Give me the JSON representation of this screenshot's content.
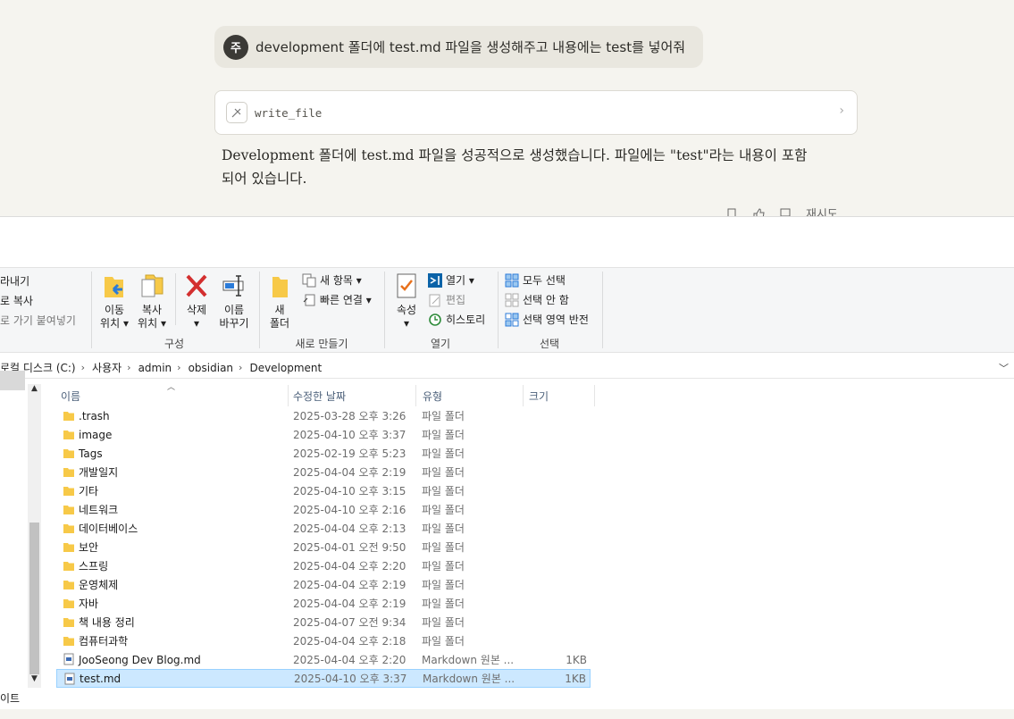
{
  "chat": {
    "avatar_initial": "주",
    "user_message": "development 폴더에 test.md 파일을 생성해주고 내용에는 test를 넣어줘",
    "tool_name": "write_file",
    "assistant_line1": "Development 폴더에 test.md 파일을 성공적으로 생성했습니다. 파일에는 \"test\"라는 내용이 포함",
    "assistant_line2": "되어 있습니다.",
    "retry_label": "재시도"
  },
  "ribbon": {
    "clipboard": {
      "cut_partial": "라내기",
      "copy_path_partial": "로 복사",
      "paste_shortcut_partial": "로 가기 붙여넣기"
    },
    "organize": {
      "move_to": [
        "이동",
        "위치"
      ],
      "copy_to": [
        "복사",
        "위치"
      ],
      "delete": "삭제",
      "rename": [
        "이름",
        "바꾸기"
      ],
      "label": "구성"
    },
    "new": {
      "new_folder": [
        "새",
        "폴더"
      ],
      "new_item": "새 항목",
      "easy_access": "빠른 연결",
      "label": "새로 만들기"
    },
    "open": {
      "properties": "속성",
      "open": "열기",
      "edit": "편집",
      "history": "히스토리",
      "label": "열기"
    },
    "select": {
      "select_all": "모두 선택",
      "select_none": "선택 안 함",
      "invert": "선택 영역 반전",
      "label": "선택"
    }
  },
  "address": [
    "로컬 디스크 (C:)",
    "사용자",
    "admin",
    "obsidian",
    "Development"
  ],
  "columns": {
    "name": "이름",
    "date": "수정한 날짜",
    "type": "유형",
    "size": "크기"
  },
  "files": [
    {
      "name": ".trash",
      "date": "2025-03-28 오후 3:26",
      "type": "파일 폴더",
      "size": "",
      "kind": "folder"
    },
    {
      "name": "image",
      "date": "2025-04-10 오후 3:37",
      "type": "파일 폴더",
      "size": "",
      "kind": "folder"
    },
    {
      "name": "Tags",
      "date": "2025-02-19 오후 5:23",
      "type": "파일 폴더",
      "size": "",
      "kind": "folder"
    },
    {
      "name": "개발일지",
      "date": "2025-04-04 오후 2:19",
      "type": "파일 폴더",
      "size": "",
      "kind": "folder"
    },
    {
      "name": "기타",
      "date": "2025-04-10 오후 3:15",
      "type": "파일 폴더",
      "size": "",
      "kind": "folder"
    },
    {
      "name": "네트워크",
      "date": "2025-04-10 오후 2:16",
      "type": "파일 폴더",
      "size": "",
      "kind": "folder"
    },
    {
      "name": "데이터베이스",
      "date": "2025-04-04 오후 2:13",
      "type": "파일 폴더",
      "size": "",
      "kind": "folder"
    },
    {
      "name": "보안",
      "date": "2025-04-01 오전 9:50",
      "type": "파일 폴더",
      "size": "",
      "kind": "folder"
    },
    {
      "name": "스프링",
      "date": "2025-04-04 오후 2:20",
      "type": "파일 폴더",
      "size": "",
      "kind": "folder"
    },
    {
      "name": "운영체제",
      "date": "2025-04-04 오후 2:19",
      "type": "파일 폴더",
      "size": "",
      "kind": "folder"
    },
    {
      "name": "자바",
      "date": "2025-04-04 오후 2:19",
      "type": "파일 폴더",
      "size": "",
      "kind": "folder"
    },
    {
      "name": "책 내용 정리",
      "date": "2025-04-07 오전 9:34",
      "type": "파일 폴더",
      "size": "",
      "kind": "folder"
    },
    {
      "name": "컴퓨터과학",
      "date": "2025-04-04 오후 2:18",
      "type": "파일 폴더",
      "size": "",
      "kind": "folder"
    },
    {
      "name": "JooSeong Dev Blog.md",
      "date": "2025-04-04 오후 2:20",
      "type": "Markdown 원본 ...",
      "size": "1KB",
      "kind": "md"
    },
    {
      "name": "test.md",
      "date": "2025-04-10 오후 3:37",
      "type": "Markdown 원본 ...",
      "size": "1KB",
      "kind": "md",
      "selected": true
    }
  ],
  "status_partial": "이트",
  "colors": {
    "accent_select": "#cce8ff",
    "folder": "#f7c948",
    "delete_red": "#d32f2f"
  }
}
